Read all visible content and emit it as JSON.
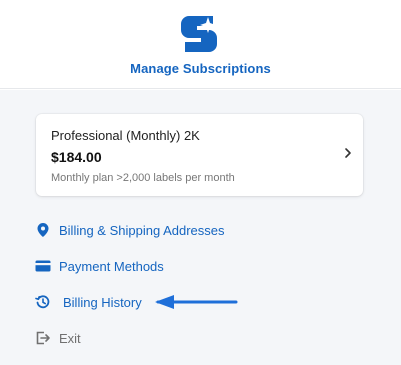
{
  "header": {
    "title": "Manage Subscriptions",
    "logo_icon": "bolt-s-logo-icon",
    "brand_color": "#1565c0"
  },
  "plan": {
    "name": "Professional (Monthly) 2K",
    "price": "$184.00",
    "description": "Monthly plan >2,000 labels per month",
    "chevron_icon": "chevron-right-icon"
  },
  "nav": {
    "items": [
      {
        "label": "Billing & Shipping Addresses",
        "icon": "map-pin-icon"
      },
      {
        "label": "Payment Methods",
        "icon": "credit-card-icon"
      },
      {
        "label": "Billing History",
        "icon": "history-icon"
      },
      {
        "label": "Exit",
        "icon": "exit-icon"
      }
    ]
  },
  "annotation": {
    "arrow_color": "#1e6fd9",
    "points_to": "Billing History"
  }
}
